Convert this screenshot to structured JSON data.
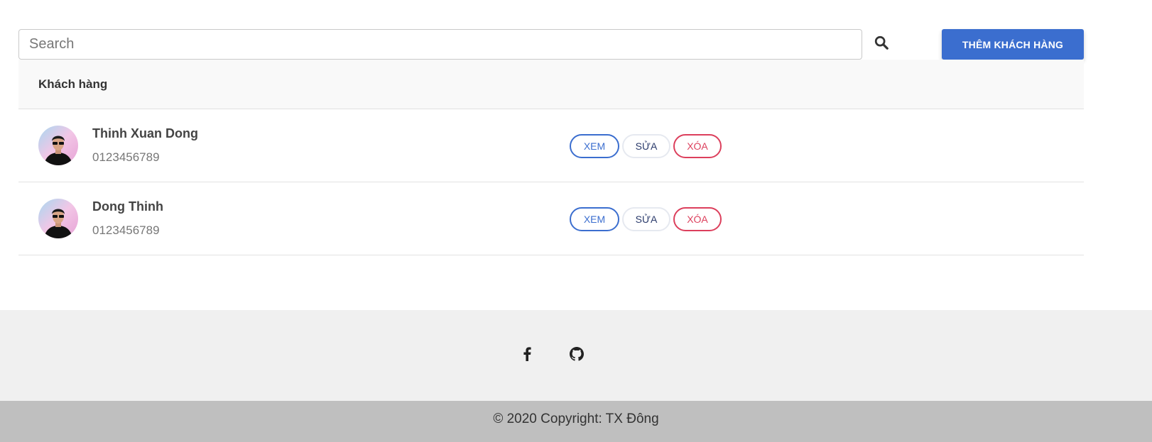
{
  "search": {
    "placeholder": "Search",
    "value": "",
    "icon": "search-icon"
  },
  "toolbar": {
    "add_label": "THÊM KHÁCH HÀNG"
  },
  "table": {
    "header": "Khách hàng",
    "rows": [
      {
        "name": "Thinh Xuan Dong",
        "phone": "0123456789"
      },
      {
        "name": "Dong Thinh",
        "phone": "0123456789"
      }
    ],
    "actions": {
      "view": "XEM",
      "edit": "SỬA",
      "delete": "XÓA"
    }
  },
  "footer": {
    "social": [
      "facebook-icon",
      "github-icon"
    ],
    "copyright": "© 2020 Copyright: TX Đông"
  },
  "colors": {
    "primary": "#3b6ecf",
    "danger": "#dc3f5c",
    "footer_light": "#f0f0f0",
    "footer_dark": "#bfbfbf"
  }
}
